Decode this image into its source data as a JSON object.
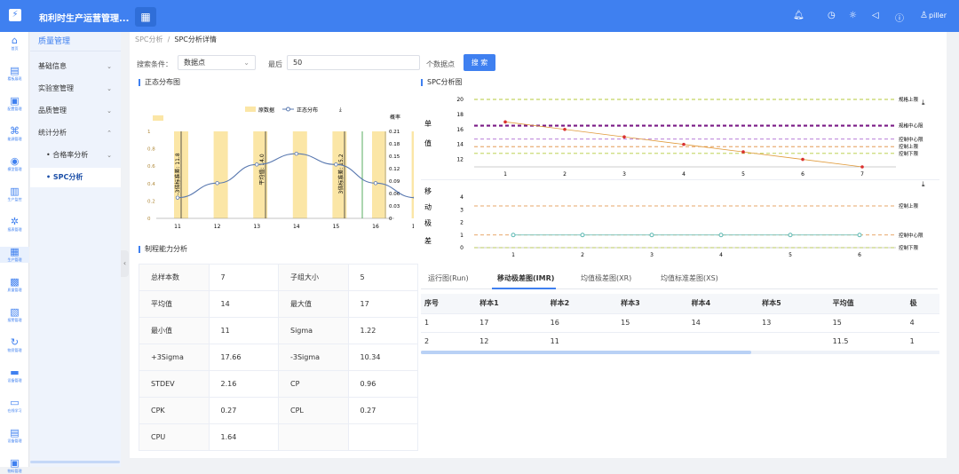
{
  "app": {
    "title": "和利时生产运营管理...",
    "logo": "grid-logo",
    "user": "piller"
  },
  "rail": [
    {
      "label": "首页",
      "icon": "home"
    },
    {
      "label": "看板展现",
      "icon": "dashboard"
    },
    {
      "label": "配置管理",
      "icon": "config"
    },
    {
      "label": "能源管理",
      "icon": "energy"
    },
    {
      "label": "模型管理",
      "icon": "model"
    },
    {
      "label": "生产监控",
      "icon": "monitor"
    },
    {
      "label": "报表管理",
      "icon": "report"
    },
    {
      "label": "生产管理",
      "icon": "production"
    },
    {
      "label": "质量管理",
      "icon": "quality"
    },
    {
      "label": "报警管理",
      "icon": "alarm"
    },
    {
      "label": "物资管理",
      "icon": "material"
    },
    {
      "label": "设备管理",
      "icon": "device"
    },
    {
      "label": "在线学习",
      "icon": "learn"
    },
    {
      "label": "设备管理",
      "icon": "device2"
    },
    {
      "label": "物料管理",
      "icon": "box"
    }
  ],
  "menu": {
    "header": "质量管理",
    "items": [
      "基础信息",
      "实验室管理",
      "品质管理",
      "统计分析",
      "合格率分析",
      "SPC分析"
    ]
  },
  "breadcrumb": {
    "parent": "SPC分析",
    "current": "SPC分析详情"
  },
  "search": {
    "label": "搜索条件：",
    "select_value": "数据点",
    "last_label": "最后",
    "count": "50",
    "unit": "个数据点",
    "button": "搜 索"
  },
  "sections": {
    "normal": "正态分布图",
    "spc": "SPC分析图",
    "capability": "制程能力分析"
  },
  "normal_chart": {
    "legend_raw": "原数据",
    "legend_normal": "正态分布",
    "y_right_title": "概率",
    "x_ticks": [
      "11",
      "12",
      "13",
      "14",
      "15",
      "16",
      "17"
    ],
    "y_left_ticks": [
      "0",
      "0.2",
      "0.4",
      "0.6",
      "0.8",
      "1"
    ],
    "y_right_ticks": [
      "0",
      "0.03",
      "0.06",
      "0.09",
      "0.12",
      "0.15",
      "0.18",
      "0.21"
    ],
    "lines": {
      "lsl": "-3倍标准差: 11.8",
      "mean": "平均值: 14.0",
      "usl": "3倍标准差: 15.2"
    }
  },
  "individual_chart": {
    "side_label": [
      "单",
      "值"
    ],
    "x_ticks": [
      "1",
      "2",
      "3",
      "4",
      "5",
      "6",
      "7"
    ],
    "y_ticks": [
      "12",
      "14",
      "16",
      "18",
      "20"
    ],
    "limits": {
      "spec_upper": "规格上限",
      "spec_center": "规格中心限",
      "control_center": "控制中心限",
      "control_upper": "控制上限",
      "control_lower": "控制下限"
    }
  },
  "moving_chart": {
    "side_label": [
      "移",
      "动",
      "极",
      "差"
    ],
    "x_ticks": [
      "1",
      "2",
      "3",
      "4",
      "5",
      "6"
    ],
    "y_ticks": [
      "0",
      "1",
      "2",
      "3",
      "4"
    ],
    "limits": {
      "control_upper": "控制上限",
      "control_center": "控制中心限",
      "control_lower": "控制下限"
    }
  },
  "chart_data": [
    {
      "type": "bar",
      "title": "正态分布图",
      "categories": [
        "11",
        "12",
        "13",
        "14",
        "15",
        "16",
        "17"
      ],
      "series": [
        {
          "name": "原数据",
          "values": [
            1,
            1,
            1,
            1,
            1,
            1,
            1
          ]
        },
        {
          "name": "正态分布",
          "values": [
            0.05,
            0.085,
            0.13,
            0.156,
            0.13,
            0.085,
            0.05
          ]
        }
      ],
      "ylim": [
        0,
        1
      ],
      "y2lim": [
        0,
        0.21
      ],
      "annotations": [
        "-3倍标准差: 11.8",
        "平均值: 14.0",
        "3倍标准差: 15.2"
      ]
    },
    {
      "type": "line",
      "title": "SPC分析图",
      "x": [
        1,
        2,
        3,
        4,
        5,
        6,
        7
      ],
      "series": [
        {
          "name": "单值",
          "values": [
            17,
            16,
            15,
            14,
            13,
            12,
            11
          ]
        }
      ],
      "ylim": [
        11,
        20
      ],
      "reference": {
        "规格上限": 20,
        "规格中心限": 16.5,
        "控制中心限": 14.7,
        "控制上限": 13.7,
        "控制下限": 12.8
      }
    },
    {
      "type": "line",
      "x": [
        1,
        2,
        3,
        4,
        5,
        6
      ],
      "series": [
        {
          "name": "移动极差",
          "values": [
            1,
            1,
            1,
            1,
            1,
            1
          ]
        }
      ],
      "ylim": [
        0,
        4
      ],
      "reference": {
        "控制上限": 3.3,
        "控制中心限": 1,
        "控制下限": 0
      }
    }
  ],
  "capability": [
    [
      "总样本数",
      "7",
      "子组大小",
      "5"
    ],
    [
      "平均值",
      "14",
      "最大值",
      "17"
    ],
    [
      "最小值",
      "11",
      "Sigma",
      "1.22"
    ],
    [
      "+3Sigma",
      "17.66",
      "-3Sigma",
      "10.34"
    ],
    [
      "STDEV",
      "2.16",
      "CP",
      "0.96"
    ],
    [
      "CPK",
      "0.27",
      "CPL",
      "0.27"
    ],
    [
      "CPU",
      "1.64",
      "",
      ""
    ]
  ],
  "tabs": [
    "运行图(Run)",
    "移动极差图(IMR)",
    "均值极差图(XR)",
    "均值标准差图(XS)"
  ],
  "table": {
    "headers": [
      "序号",
      "样本1",
      "样本2",
      "样本3",
      "样本4",
      "样本5",
      "平均值",
      "极"
    ],
    "rows": [
      [
        "1",
        "17",
        "16",
        "15",
        "14",
        "13",
        "15",
        "4"
      ],
      [
        "2",
        "12",
        "11",
        "",
        "",
        "",
        "11.5",
        "1"
      ]
    ]
  },
  "colors": {
    "primary": "#3f80f0",
    "bar": "#fbe6a6",
    "line": "#5a79b0",
    "spec": "#b4c93a",
    "center": "#7a1a86",
    "control": "#e08a3a",
    "purple": "#a14fc9"
  }
}
